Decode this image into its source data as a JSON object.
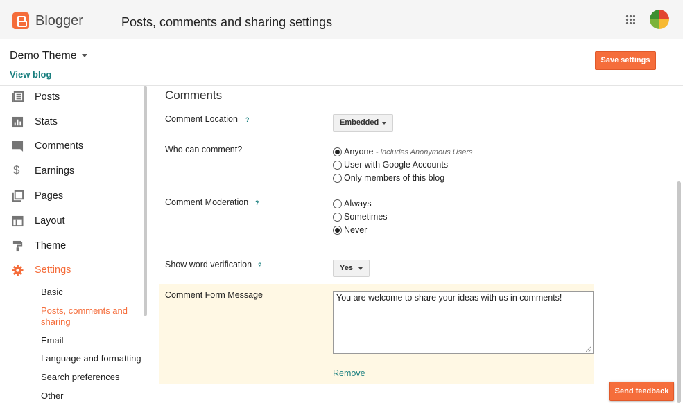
{
  "app": {
    "brand": "Blogger",
    "page_title": "Posts, comments and sharing settings"
  },
  "blog": {
    "name": "Demo Theme",
    "view_blog": "View blog"
  },
  "toolbar": {
    "save_label": "Save settings"
  },
  "sidebar": {
    "items": [
      {
        "label": "Posts",
        "icon": "posts-icon"
      },
      {
        "label": "Stats",
        "icon": "stats-icon"
      },
      {
        "label": "Comments",
        "icon": "comments-icon"
      },
      {
        "label": "Earnings",
        "icon": "dollar-icon"
      },
      {
        "label": "Pages",
        "icon": "pages-icon"
      },
      {
        "label": "Layout",
        "icon": "layout-icon"
      },
      {
        "label": "Theme",
        "icon": "paint-roller-icon"
      },
      {
        "label": "Settings",
        "icon": "gear-icon",
        "active": true
      }
    ],
    "sub_items": [
      {
        "label": "Basic"
      },
      {
        "label": "Posts, comments and sharing",
        "active": true
      },
      {
        "label": "Email"
      },
      {
        "label": "Language and formatting"
      },
      {
        "label": "Search preferences"
      },
      {
        "label": "Other"
      }
    ]
  },
  "comments": {
    "title": "Comments",
    "location": {
      "label": "Comment Location",
      "help": "?",
      "value": "Embedded"
    },
    "who_can_comment": {
      "label": "Who can comment?",
      "options": [
        {
          "label": "Anyone",
          "note": "- includes Anonymous Users",
          "checked": true
        },
        {
          "label": "User with Google Accounts",
          "checked": false
        },
        {
          "label": "Only members of this blog",
          "checked": false
        }
      ]
    },
    "moderation": {
      "label": "Comment Moderation",
      "help": "?",
      "options": [
        {
          "label": "Always",
          "checked": false
        },
        {
          "label": "Sometimes",
          "checked": false
        },
        {
          "label": "Never",
          "checked": true
        }
      ]
    },
    "word_verification": {
      "label": "Show word verification",
      "help": "?",
      "value": "Yes"
    },
    "form_message": {
      "label": "Comment Form Message",
      "value": "You are welcome to share your ideas with us in comments!",
      "remove": "Remove"
    }
  },
  "feedback": {
    "label": "Send feedback"
  },
  "colors": {
    "accent": "#f56d3b",
    "link": "#1a7f7f",
    "highlight": "#fff8e4"
  }
}
